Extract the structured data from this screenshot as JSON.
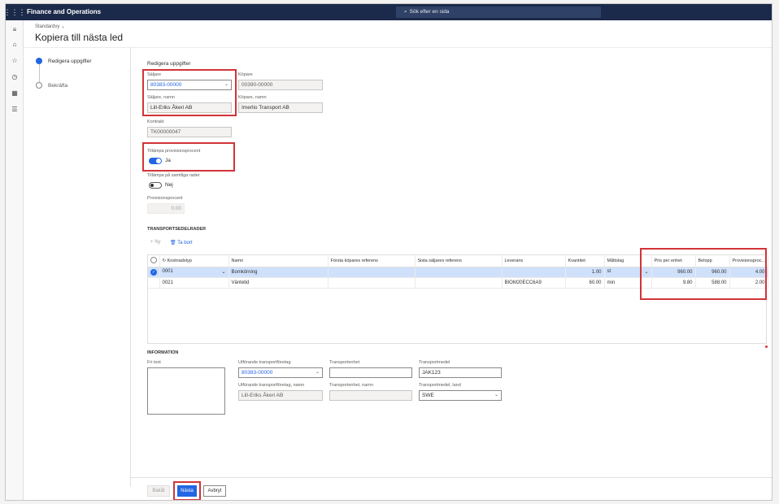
{
  "app": {
    "name": "Finance and Operations",
    "search_placeholder": "Sök efter en sida"
  },
  "header": {
    "view": "Standardvy",
    "title": "Kopiera till nästa led"
  },
  "steps": [
    {
      "label": "Redigera uppgifter"
    },
    {
      "label": "Bekräfta"
    }
  ],
  "form": {
    "section_title": "Redigera uppgifter",
    "saljare": {
      "label": "Säljare",
      "value": "80383-00000"
    },
    "kopare": {
      "label": "Köpare",
      "value": "00390-00000"
    },
    "saljare_namn": {
      "label": "Säljare, namn",
      "value": "Lill-Eriks Åkeri AB"
    },
    "kopare_namn": {
      "label": "Köpare, namn",
      "value": "Imerlio Transport AB"
    },
    "kontrakt": {
      "label": "Kontrakt",
      "value": "TK00000047"
    },
    "provision_toggle": {
      "label": "Tillämpa provisionsprocent",
      "value": "Ja"
    },
    "all_rows_toggle": {
      "label": "Tillämpa på samtliga rader",
      "value": "Nej"
    },
    "provisionsprocent": {
      "label": "Provisionsprocent",
      "value": "0.00"
    }
  },
  "transport": {
    "section_title": "TRANSPORTSEDELRADER",
    "new_label": "Ny",
    "delete_label": "Ta bort",
    "columns": [
      "Kostnadstyp",
      "Namn",
      "Första köpares referens",
      "Sista säljares referens",
      "Leverans",
      "Kvantitet",
      "Måttslag",
      "Pris per enhet",
      "Belopp",
      "Provisionsproc..."
    ],
    "rows": [
      {
        "kostnadstyp": "0001",
        "namn": "Bomkörning",
        "forsta": "",
        "sista": "",
        "leverans": "",
        "kvantitet": "1.00",
        "mattslag": "st",
        "pris": "960.00",
        "belopp": "960.00",
        "provision": "4.00"
      },
      {
        "kostnadstyp": "0021",
        "namn": "Väntetid",
        "forsta": "",
        "sista": "",
        "leverans": "BIOM20ECC6A9",
        "kvantitet": "60.00",
        "mattslag": "min",
        "pris": "9.80",
        "belopp": "588.00",
        "provision": "2.00"
      }
    ]
  },
  "information": {
    "section_title": "INFORMATION",
    "fritext": {
      "label": "Fri text",
      "value": ""
    },
    "utforande": {
      "label": "Utförande transportföretag",
      "value": "80383-00000"
    },
    "utforande_namn": {
      "label": "Utförande transportföretag, namn",
      "value": "Lill-Eriks Åkeri AB"
    },
    "transportenhet": {
      "label": "Transportenhet",
      "value": ""
    },
    "transportenhet_namn": {
      "label": "Transportenhet, namn",
      "value": ""
    },
    "transportmedel": {
      "label": "Transportmedel",
      "value": "JAK123"
    },
    "transportmedel_land": {
      "label": "Transportmedel, land",
      "value": "SWE"
    }
  },
  "footer": {
    "back": "Bakåt",
    "next": "Nästa",
    "cancel": "Avbryt"
  }
}
